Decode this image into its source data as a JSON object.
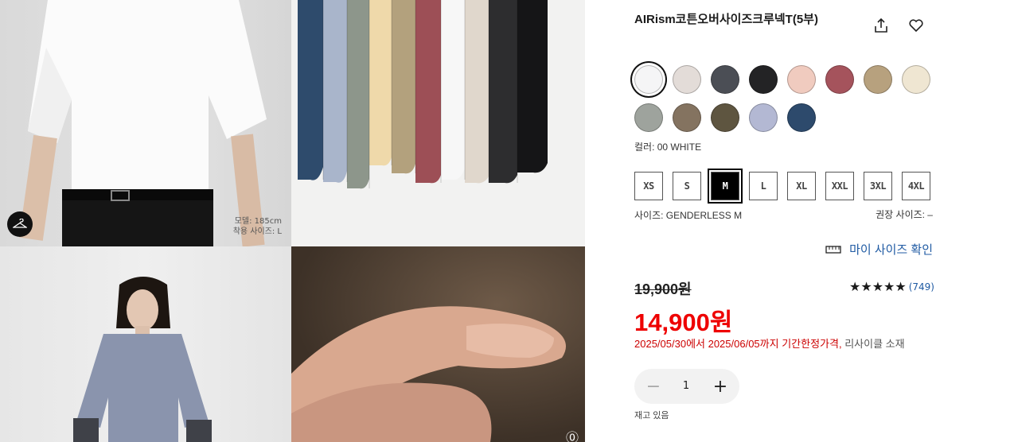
{
  "product": {
    "title": "AIRism코튼오버사이즈크루넥T(5부)"
  },
  "images": {
    "model_caption_height": "모델: 185cm",
    "model_caption_size": "착용 사이즈: L"
  },
  "colors": {
    "swatches": [
      {
        "hex": "#f5f5f6",
        "selected": true
      },
      {
        "hex": "#e3dcd8"
      },
      {
        "hex": "#4b4e55"
      },
      {
        "hex": "#232325"
      },
      {
        "hex": "#f0cbbf"
      },
      {
        "hex": "#a5535c"
      },
      {
        "hex": "#b7a17e"
      },
      {
        "hex": "#efe6d2"
      },
      {
        "hex": "#9ea39d"
      },
      {
        "hex": "#847360"
      },
      {
        "hex": "#5e5540"
      },
      {
        "hex": "#b3b8d3"
      },
      {
        "hex": "#2d4a6c"
      }
    ],
    "selected_label": "컬러: 00 WHITE"
  },
  "sizes": {
    "options": [
      "XS",
      "S",
      "M",
      "L",
      "XL",
      "XXL",
      "3XL",
      "4XL"
    ],
    "selected": "M",
    "selected_label": "사이즈: GENDERLESS M",
    "recommended_label": "권장 사이즈: –"
  },
  "my_size_link": "마이 사이즈 확인",
  "price": {
    "original": "19,900원",
    "sale_amount": "14,900",
    "sale_unit": "원",
    "promo_text": "2025/05/30에서 2025/06/05까지 기간한정가격,",
    "promo_extra": "리사이클 소재"
  },
  "rating": {
    "stars": "★★★★★",
    "count": "(749)"
  },
  "quantity": {
    "value": "1",
    "minus": "−",
    "plus": "+"
  },
  "stock_status": "재고 있음",
  "accent_colors": {
    "sale": "#e00000",
    "link": "#1f5aa3"
  }
}
